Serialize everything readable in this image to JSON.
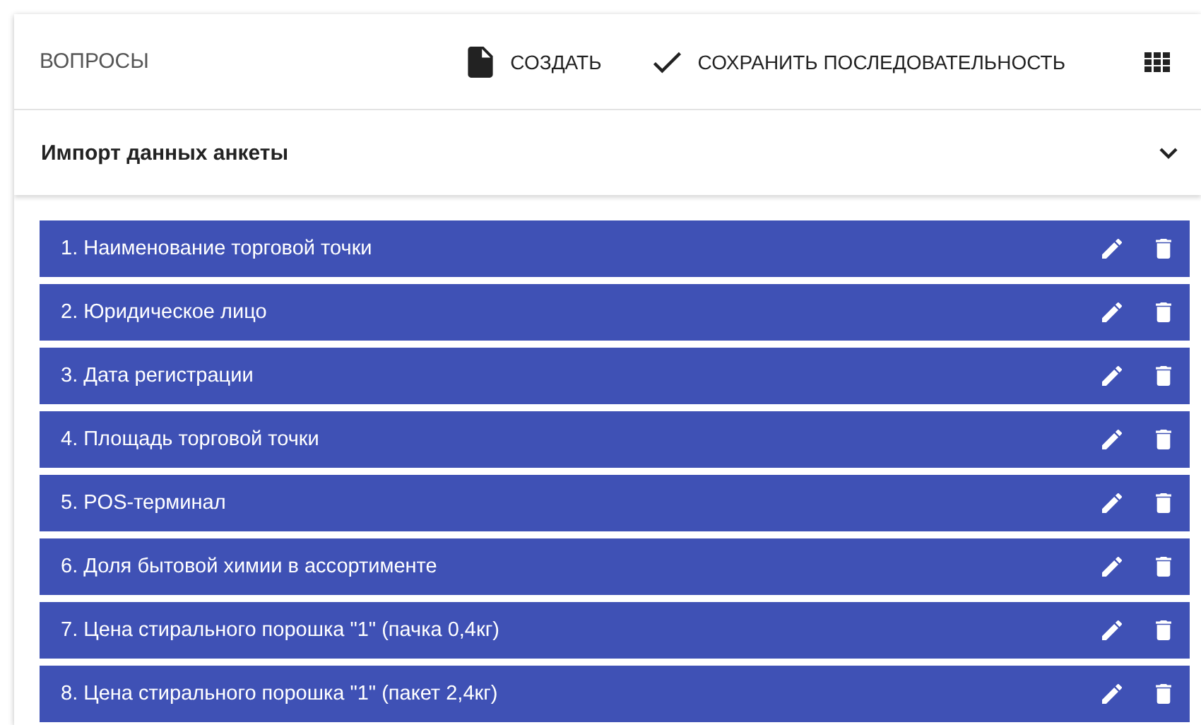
{
  "toolbar": {
    "title": "ВОПРОСЫ",
    "actions": [
      {
        "kind": "create",
        "label": "СОЗДАТЬ"
      },
      {
        "kind": "save",
        "label": "СОХРАНИТЬ ПОСЛЕДОВАТЕЛЬНОСТЬ"
      }
    ]
  },
  "import_panel": {
    "title": "Импорт данных анкеты",
    "expanded": false
  },
  "questions": [
    {
      "label": "1. Наименование торговой точки"
    },
    {
      "label": "2. Юридическое лицо"
    },
    {
      "label": "3. Дата регистрации"
    },
    {
      "label": "4. Площадь торговой точки"
    },
    {
      "label": "5. POS-терминал"
    },
    {
      "label": "6. Доля бытовой химии в ассортименте"
    },
    {
      "label": "7. Цена стирального порошка \"1\" (пачка 0,4кг)"
    },
    {
      "label": "8. Цена стирального порошка \"1\" (пакет 2,4кг)"
    }
  ]
}
